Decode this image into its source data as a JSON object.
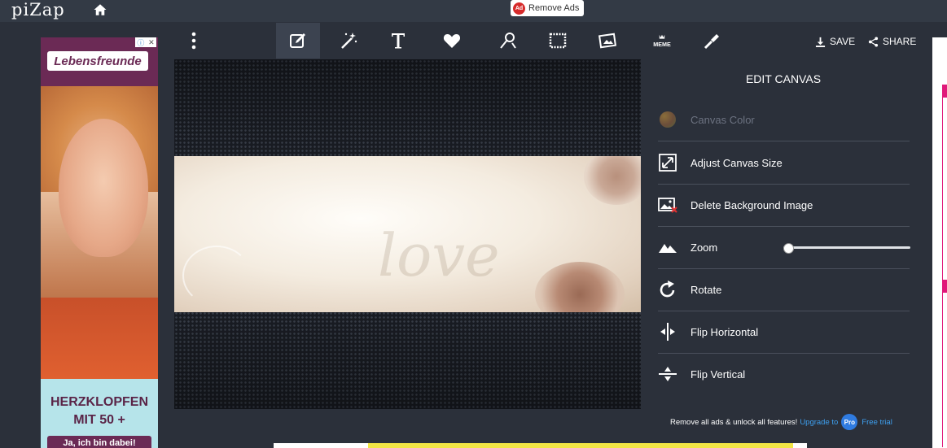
{
  "app": {
    "logo": "piZap"
  },
  "topbar": {
    "remove_ads_badge": "Ad",
    "remove_ads_label": "Remove Ads"
  },
  "left_ad": {
    "brand": "Lebensfreunde",
    "headline": "HERZKLOPFEN MIT 50 +",
    "cta": "Ja, ich bin dabei!",
    "adchoices_icons": [
      "info-icon",
      "close-icon"
    ]
  },
  "toolbar": {
    "tools": [
      {
        "name": "edit",
        "icon": "edit-icon"
      },
      {
        "name": "effects",
        "icon": "magic-wand-icon"
      },
      {
        "name": "text",
        "icon": "text-icon"
      },
      {
        "name": "stickers",
        "icon": "heart-icon"
      },
      {
        "name": "paint",
        "icon": "paint-icon"
      },
      {
        "name": "borders",
        "icon": "border-icon"
      },
      {
        "name": "add-photo",
        "icon": "add-photo-icon"
      },
      {
        "name": "meme",
        "icon": "meme-icon",
        "label": "MEME"
      },
      {
        "name": "touch-up",
        "icon": "brush-icon"
      }
    ],
    "active_tool": "edit",
    "save_label": "SAVE",
    "share_label": "SHARE"
  },
  "panel": {
    "title": "EDIT CANVAS",
    "items": [
      {
        "label": "Canvas Color",
        "icon": "color-dot-icon",
        "disabled": true
      },
      {
        "label": "Adjust Canvas Size",
        "icon": "resize-icon"
      },
      {
        "label": "Delete Background Image",
        "icon": "delete-image-icon"
      },
      {
        "label": "Zoom",
        "icon": "zoom-mountain-icon"
      },
      {
        "label": "Rotate",
        "icon": "rotate-icon"
      },
      {
        "label": "Flip Horizontal",
        "icon": "flip-horizontal-icon"
      },
      {
        "label": "Flip Vertical",
        "icon": "flip-vertical-icon"
      }
    ],
    "zoom_value": 0.0
  },
  "promo": {
    "text": "Remove all ads & unlock all features!",
    "upgrade_label": "Upgrade to",
    "pro_badge": "Pro",
    "trial_label": "Free trial"
  },
  "canvas": {
    "watermark_text": "love"
  },
  "colors": {
    "background": "#2b303a",
    "topbar": "#333a45",
    "accent_blue": "#3ea0f0",
    "ad_purple": "#6b2a55"
  }
}
